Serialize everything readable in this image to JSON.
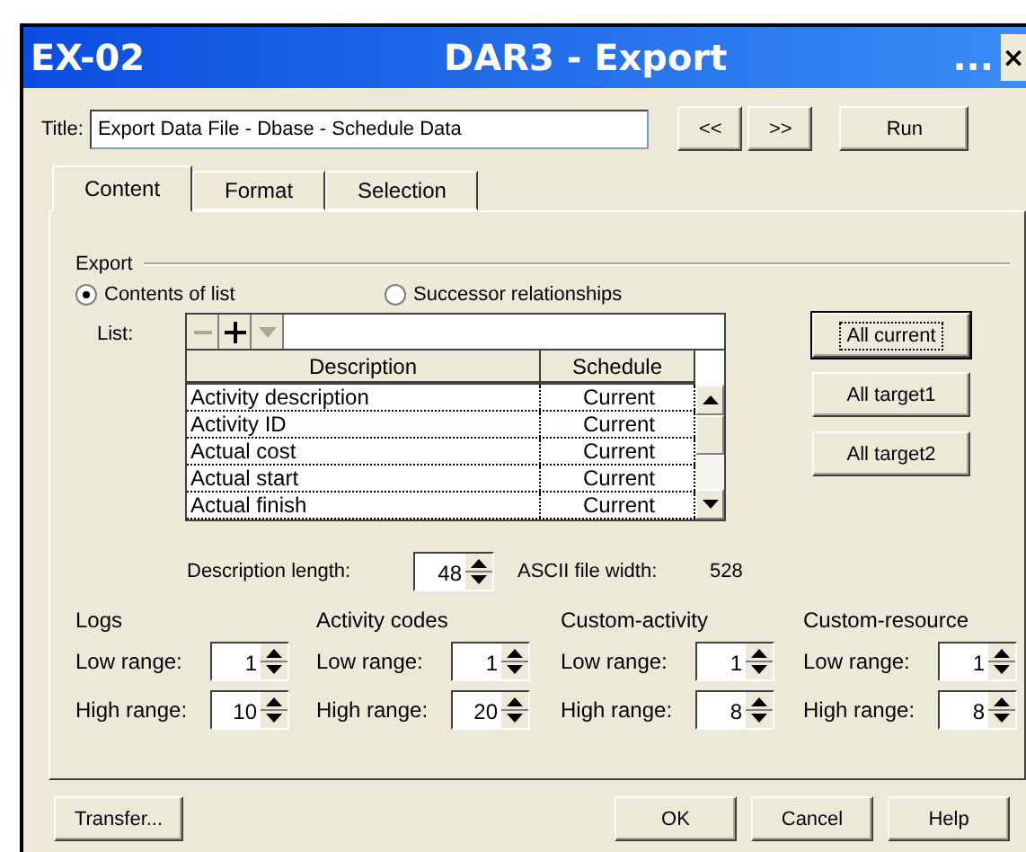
{
  "window": {
    "code": "EX-02",
    "title": "DAR3 - Export",
    "more": "...",
    "close": "×"
  },
  "title_field": {
    "label": "Title:",
    "value": "Export Data File - Dbase - Schedule Data"
  },
  "nav_buttons": [
    "<<",
    ">>"
  ],
  "run_button": "Run",
  "tabs": [
    {
      "label": "Content",
      "selected": true
    },
    {
      "label": "Format",
      "selected": false
    },
    {
      "label": "Selection",
      "selected": false
    }
  ],
  "export": {
    "heading": "Export",
    "radios": [
      {
        "label": "Contents of list",
        "selected": true
      },
      {
        "label": "Successor relationships",
        "selected": false
      }
    ],
    "list_label": "List:",
    "columns": [
      "Description",
      "Schedule"
    ],
    "rows": [
      [
        "Activity description",
        "Current"
      ],
      [
        "Activity ID",
        "Current"
      ],
      [
        "Actual cost",
        "Current"
      ],
      [
        "Actual start",
        "Current"
      ],
      [
        "Actual finish",
        "Current"
      ]
    ]
  },
  "side_buttons": [
    {
      "label": "All current",
      "focused": true
    },
    {
      "label": "All target1",
      "focused": false
    },
    {
      "label": "All target2",
      "focused": false
    }
  ],
  "description_length": {
    "label": "Description length:",
    "value": "48"
  },
  "ascii_width": {
    "label": "ASCII file width:",
    "value": "528"
  },
  "groups": [
    {
      "title": "Logs",
      "low_label": "Low range:",
      "low_value": "1",
      "high_label": "High range:",
      "high_value": "10"
    },
    {
      "title": "Activity codes",
      "low_label": "Low range:",
      "low_value": "1",
      "high_label": "High range:",
      "high_value": "20"
    },
    {
      "title": "Custom-activity",
      "low_label": "Low range:",
      "low_value": "1",
      "high_label": "High range:",
      "high_value": "8"
    },
    {
      "title": "Custom-resource",
      "low_label": "Low range:",
      "low_value": "1",
      "high_label": "High range:",
      "high_value": "8"
    }
  ],
  "transfer_button": "Transfer...",
  "footer_buttons": [
    "OK",
    "Cancel",
    "Help"
  ]
}
